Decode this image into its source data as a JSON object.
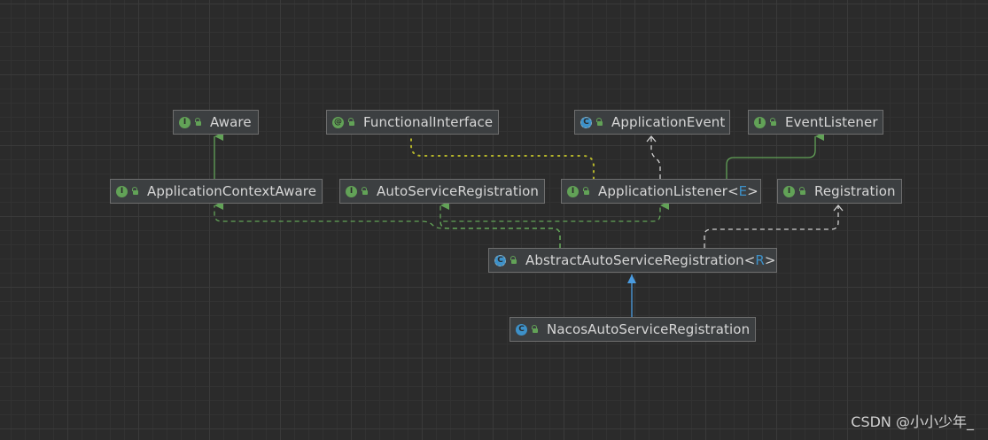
{
  "nodes": {
    "aware": {
      "kind": "interface",
      "kind_glyph": "I",
      "label": "Aware"
    },
    "functional_interface": {
      "kind": "annotation",
      "kind_glyph": "@",
      "label": "FunctionalInterface"
    },
    "application_event": {
      "kind": "abstract",
      "kind_glyph": "C",
      "label": "ApplicationEvent"
    },
    "event_listener": {
      "kind": "interface",
      "kind_glyph": "I",
      "label": "EventListener"
    },
    "application_context_aware": {
      "kind": "interface",
      "kind_glyph": "I",
      "label": "ApplicationContextAware"
    },
    "auto_service_registration": {
      "kind": "interface",
      "kind_glyph": "I",
      "label": "AutoServiceRegistration"
    },
    "application_listener": {
      "kind": "interface",
      "kind_glyph": "I",
      "label": "ApplicationListener",
      "type_open": "<",
      "type_var": "E",
      "type_close": ">"
    },
    "registration": {
      "kind": "interface",
      "kind_glyph": "I",
      "label": "Registration"
    },
    "abstract_auto_service_registration": {
      "kind": "abstract",
      "kind_glyph": "C",
      "label": "AbstractAutoServiceRegistration",
      "type_open": "<",
      "type_var": "R",
      "type_close": ">"
    },
    "nacos_auto_service_registration": {
      "kind": "class",
      "kind_glyph": "C",
      "label": "NacosAutoServiceRegistration"
    }
  },
  "edges": [
    {
      "from": "application_context_aware",
      "to": "aware",
      "type": "extends"
    },
    {
      "from": "application_listener",
      "to": "functional_interface",
      "type": "annotated"
    },
    {
      "from": "application_listener",
      "to": "application_event",
      "type": "generic-dependency"
    },
    {
      "from": "application_listener",
      "to": "event_listener",
      "type": "extends"
    },
    {
      "from": "abstract_auto_service_registration",
      "to": "application_context_aware",
      "type": "implements"
    },
    {
      "from": "abstract_auto_service_registration",
      "to": "auto_service_registration",
      "type": "implements"
    },
    {
      "from": "abstract_auto_service_registration",
      "to": "application_listener",
      "type": "implements"
    },
    {
      "from": "abstract_auto_service_registration",
      "to": "registration",
      "type": "generic-dependency"
    },
    {
      "from": "nacos_auto_service_registration",
      "to": "abstract_auto_service_registration",
      "type": "extends-class"
    }
  ],
  "colors": {
    "background": "#2b2b2b",
    "node_bg": "#3c3f41",
    "node_border": "#6e6e6e",
    "interface_green": "#62a257",
    "class_blue": "#3d91c9",
    "annotation_yellow": "#b5b52a",
    "dependency_white": "#d0d0d0"
  },
  "watermark": "CSDN @小小少年_"
}
